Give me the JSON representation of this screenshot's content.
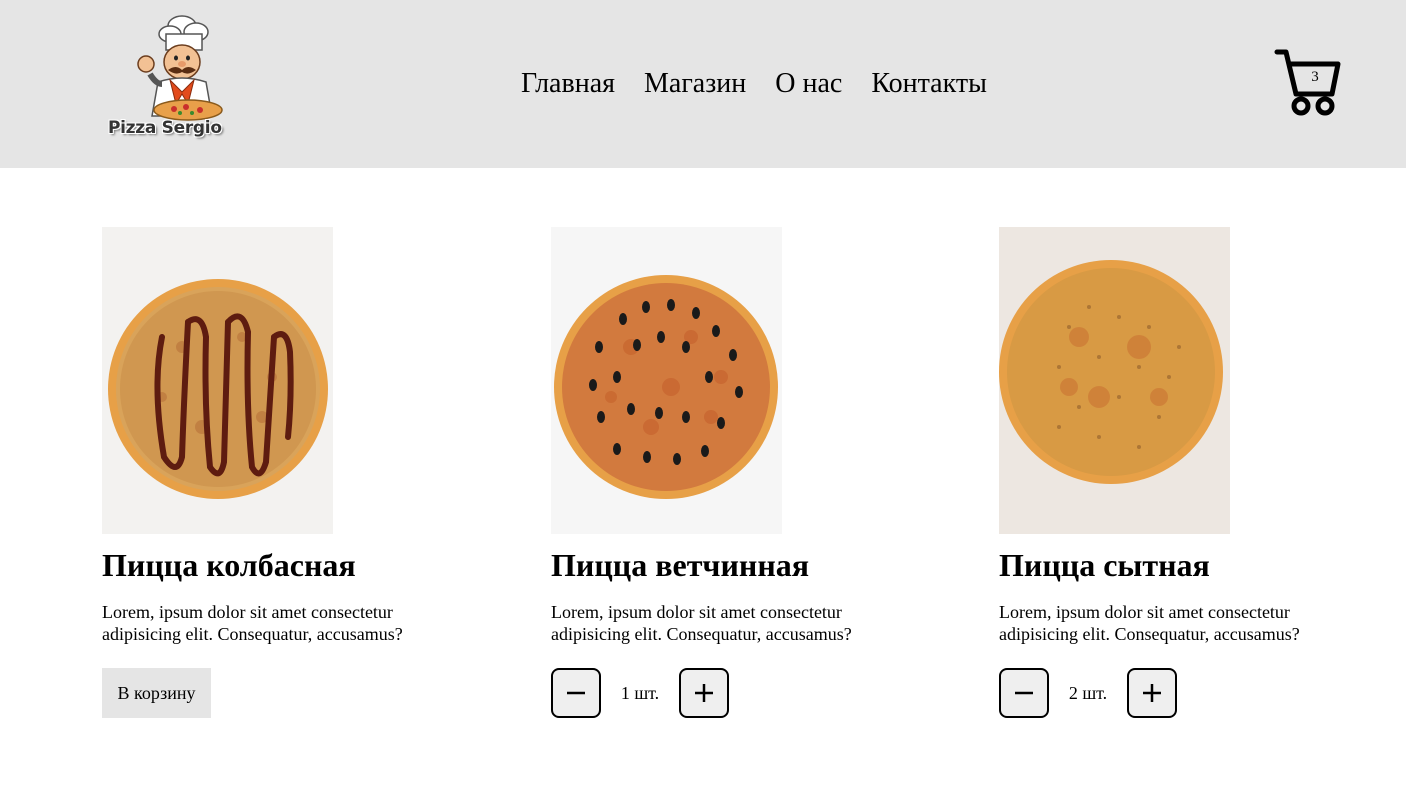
{
  "header": {
    "logo": {
      "text": "Pizza Sergio",
      "icon": "chef-logo-icon"
    },
    "nav": [
      "Главная",
      "Магазин",
      "О нас",
      "Контакты"
    ],
    "cart": {
      "icon": "cart-icon",
      "count": "3"
    }
  },
  "products": [
    {
      "title": "Пицца колбасная",
      "description": "Lorem, ipsum dolor sit amet consectetur adipisicing elit. Consequatur, accusamus?",
      "button_label": "В корзину",
      "quantity": null
    },
    {
      "title": "Пицца ветчинная",
      "description": "Lorem, ipsum dolor sit amet consectetur adipisicing elit. Consequatur, accusamus?",
      "quantity": "1 шт."
    },
    {
      "title": "Пицца сытная",
      "description": "Lorem, ipsum dolor sit amet consectetur adipisicing elit. Consequatur, accusamus?",
      "quantity": "2 шт."
    }
  ],
  "colors": {
    "header_bg": "#e5e5e5",
    "button_bg": "#e5e5e5",
    "qty_button_bg": "#efefef"
  }
}
